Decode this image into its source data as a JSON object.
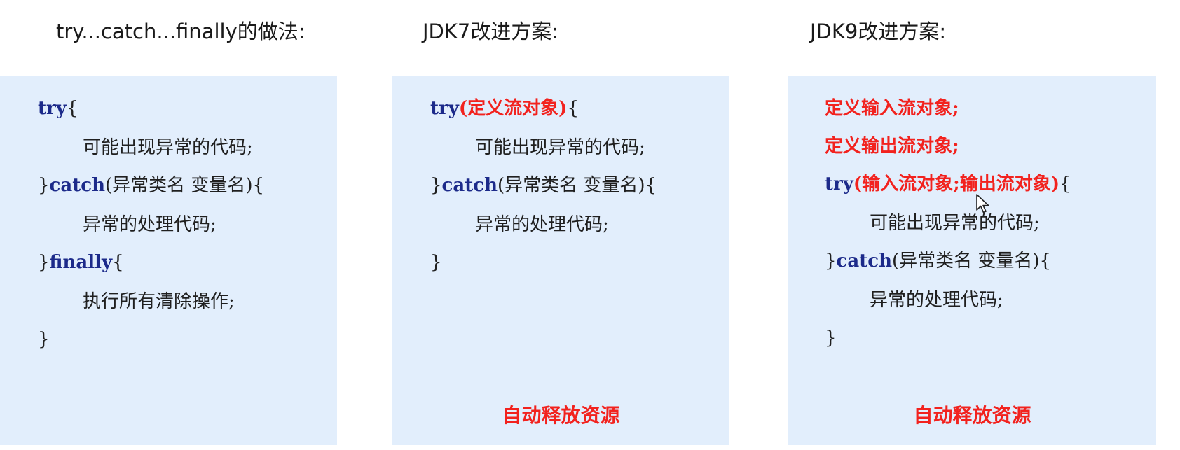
{
  "titles": {
    "col1": "try...catch...finally的做法:",
    "col2": "JDK7改进方案:",
    "col3": "JDK9改进方案:"
  },
  "panel1": {
    "try_kw": "try",
    "try_brace": "{",
    "body1": "可能出现异常的代码;",
    "catch_close": "}",
    "catch_kw": "catch",
    "catch_params": "(异常类名 变量名){",
    "handler": "异常的处理代码;",
    "finally_close": "}",
    "finally_kw": "finally",
    "finally_brace": "{",
    "cleanup": "执行所有清除操作;",
    "end": "}"
  },
  "panel2": {
    "try_kw": "try",
    "resource": "(定义流对象)",
    "try_brace": "{",
    "body1": "可能出现异常的代码;",
    "catch_close": "}",
    "catch_kw": "catch",
    "catch_params": "(异常类名 变量名){",
    "handler": "异常的处理代码;",
    "end": "}",
    "footer": "自动释放资源"
  },
  "panel3": {
    "def_in": "定义输入流对象;",
    "def_out": "定义输出流对象;",
    "try_kw": "try",
    "resources": "(输入流对象;输出流对象)",
    "try_brace": "{",
    "body1": "可能出现异常的代码;",
    "catch_close": "}",
    "catch_kw": "catch",
    "catch_params": "(异常类名 变量名){",
    "handler": "异常的处理代码;",
    "end": "}",
    "footer": "自动释放资源"
  },
  "colors": {
    "panel_bg": "#e2eefc",
    "keyword": "#1c2a8a",
    "highlight": "#f2221e"
  },
  "icons": {
    "pointer": "mouse-cursor-icon"
  }
}
